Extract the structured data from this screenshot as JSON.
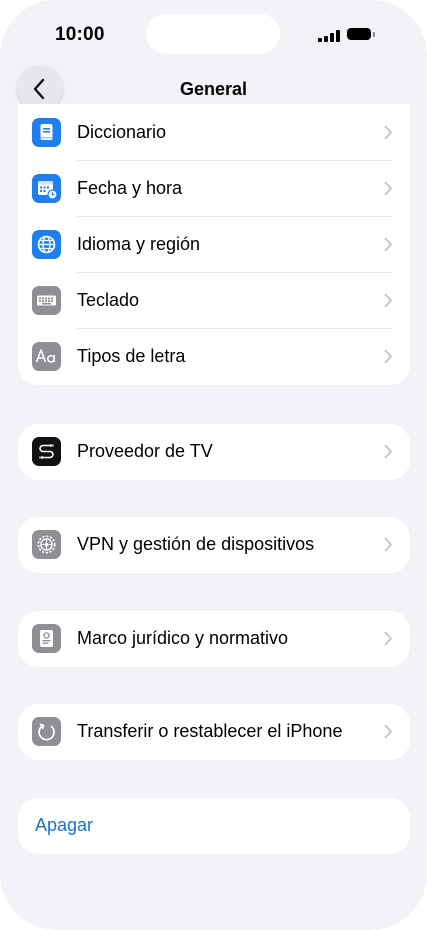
{
  "status_bar": {
    "time": "10:00"
  },
  "nav": {
    "title": "General"
  },
  "groups": [
    {
      "items": [
        {
          "label": "Diccionario",
          "icon": "dictionary-icon",
          "icon_bg": "#1f7ff0"
        },
        {
          "label": "Fecha y hora",
          "icon": "calendar-clock-icon",
          "icon_bg": "#1f7ff0"
        },
        {
          "label": "Idioma y región",
          "icon": "globe-icon",
          "icon_bg": "#1f7ff0"
        },
        {
          "label": "Teclado",
          "icon": "keyboard-icon",
          "icon_bg": "#8e8e93"
        },
        {
          "label": "Tipos de letra",
          "icon": "font-icon",
          "icon_bg": "#8e8e93"
        }
      ]
    },
    {
      "items": [
        {
          "label": "Proveedor de TV",
          "icon": "tv-provider-icon",
          "icon_bg": "#111111"
        }
      ]
    },
    {
      "items": [
        {
          "label": "VPN y gestión de dispositivos",
          "icon": "gear-icon",
          "icon_bg": "#8e8e93"
        }
      ]
    },
    {
      "items": [
        {
          "label": "Marco jurídico y normativo",
          "icon": "certificate-icon",
          "icon_bg": "#8e8e93"
        }
      ]
    },
    {
      "items": [
        {
          "label": "Transferir o restablecer el iPhone",
          "icon": "reset-icon",
          "icon_bg": "#8e8e93"
        }
      ]
    },
    {
      "items": [
        {
          "label": "Apagar"
        }
      ]
    }
  ]
}
